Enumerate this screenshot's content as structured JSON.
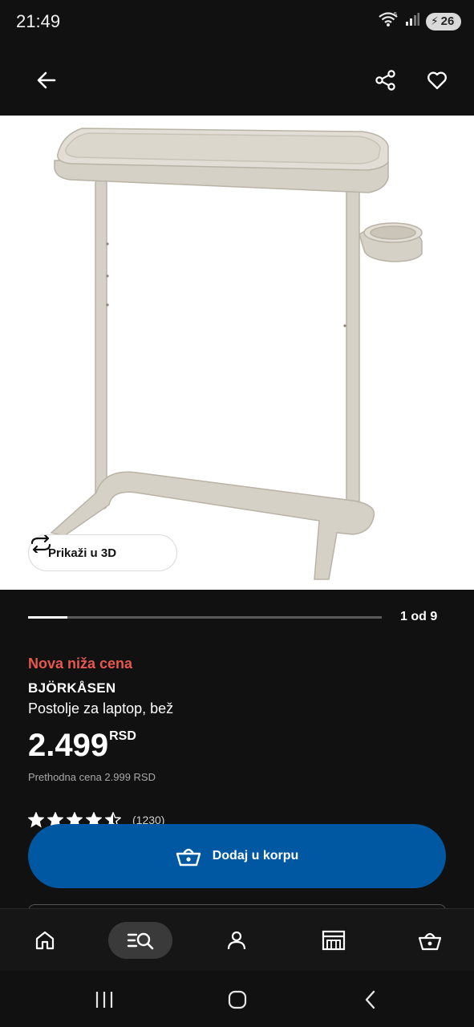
{
  "status_bar": {
    "time": "21:49",
    "battery_level": "26",
    "wifi_label": "5",
    "icons": [
      "wifi-icon",
      "signal-icon",
      "battery-icon"
    ]
  },
  "header": {
    "icons": [
      "back-arrow-icon",
      "share-icon",
      "heart-icon"
    ]
  },
  "product_image": {
    "view_3d_label": "Prikaži u 3D",
    "view_3d_icon": "rotate-3d-icon"
  },
  "gallery": {
    "counter": "1 od 9",
    "progress": 0.111
  },
  "product": {
    "promo_label": "Nova niža cena",
    "name": "BJÖRKÅSEN",
    "description": "Postolje za laptop, bež",
    "price": "2.499",
    "currency": "RSD",
    "previous_price": "Prethodna cena 2.999 RSD",
    "rating": 4.5,
    "rating_count": "(1230)"
  },
  "cart": {
    "add_label": "Dodaj u korpu",
    "icon": "basket-icon"
  },
  "bottom_nav": {
    "items": [
      {
        "icon": "home-icon",
        "active": false
      },
      {
        "icon": "search-list-icon",
        "active": true
      },
      {
        "icon": "profile-icon",
        "active": false
      },
      {
        "icon": "store-icon",
        "active": false
      },
      {
        "icon": "cart-basket-icon",
        "active": false
      }
    ]
  },
  "colors": {
    "background": "#111111",
    "promo": "#e8574f",
    "primary_button": "#0058a3",
    "product_beige": "#d6d1c6"
  }
}
